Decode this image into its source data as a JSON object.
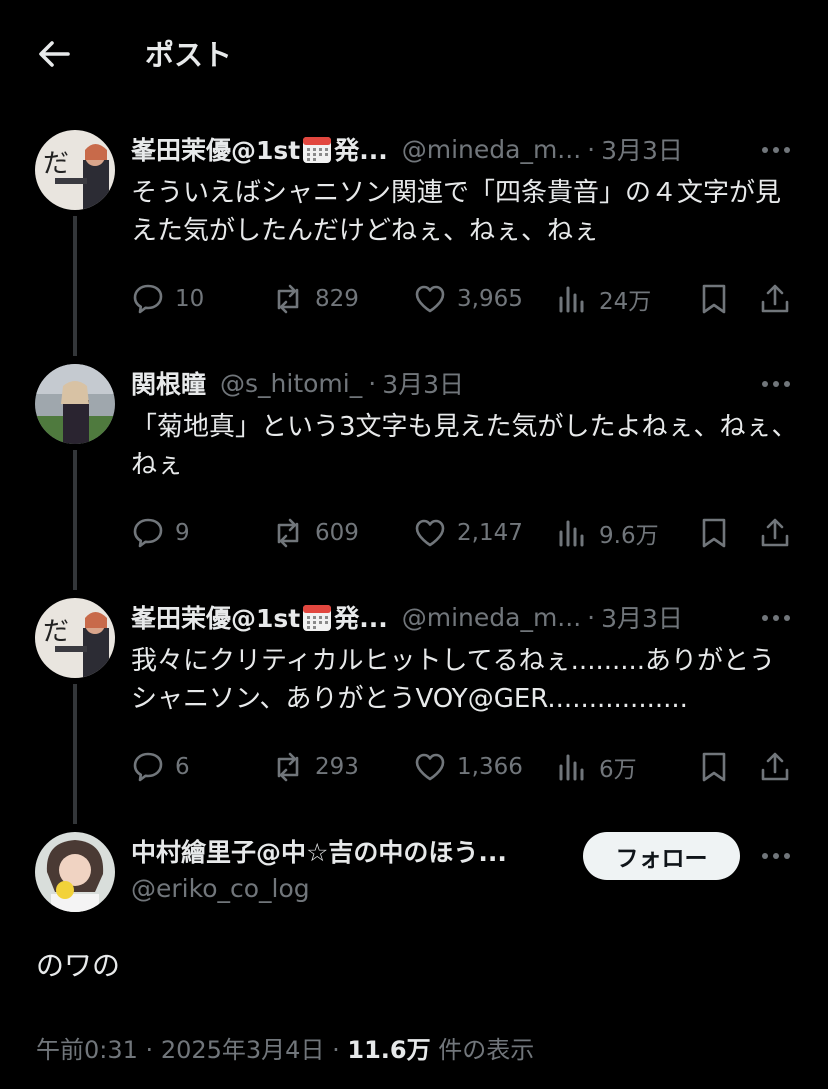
{
  "header": {
    "title": "ポスト"
  },
  "thread": [
    {
      "name_a": "峯田茉優@1st",
      "name_b": "発...",
      "handle": "@mineda_m...",
      "dot": "·",
      "time": "3月3日",
      "text": "そういえばシャニソン関連で「四条貴音」の４文字が見えた気がしたんだけどねぇ、ねぇ、ねぇ",
      "replies": "10",
      "reposts": "829",
      "likes": "3,965",
      "views": "24万",
      "avatar_glyph": "だ"
    },
    {
      "name_a": "関根瞳",
      "handle": "@s_hitomi_",
      "dot": "·",
      "time": "3月3日",
      "text": "「菊地真」という3文字も見えた気がしたよねぇ、ねぇ、ねぇ",
      "replies": "9",
      "reposts": "609",
      "likes": "2,147",
      "views": "9.6万"
    },
    {
      "name_a": "峯田茉優@1st",
      "name_b": "発...",
      "handle": "@mineda_m...",
      "dot": "·",
      "time": "3月3日",
      "text": "我々にクリティカルヒットしてるねぇ.........ありがとうシャニソン、ありがとうVOY@GER.................",
      "replies": "6",
      "reposts": "293",
      "likes": "1,366",
      "views": "6万",
      "avatar_glyph": "だ"
    }
  ],
  "main": {
    "name": "中村繪里子@中☆吉の中のほう...",
    "handle": "@eriko_co_log",
    "follow_label": "フォロー",
    "text": "のワの",
    "time": "午前0:31",
    "dot": "·",
    "date": "2025年3月4日",
    "views": "11.6万",
    "views_label": "件の表示"
  },
  "icons": [
    "back-arrow-icon",
    "more-icon",
    "reply-icon",
    "repost-icon",
    "like-icon",
    "views-icon",
    "bookmark-icon",
    "share-icon",
    "calendar-emoji-icon"
  ],
  "colors": {
    "background": "#000000",
    "text": "#e7e9ea",
    "secondary": "#71767b",
    "line": "#333639",
    "follow_bg": "#eff3f4"
  }
}
